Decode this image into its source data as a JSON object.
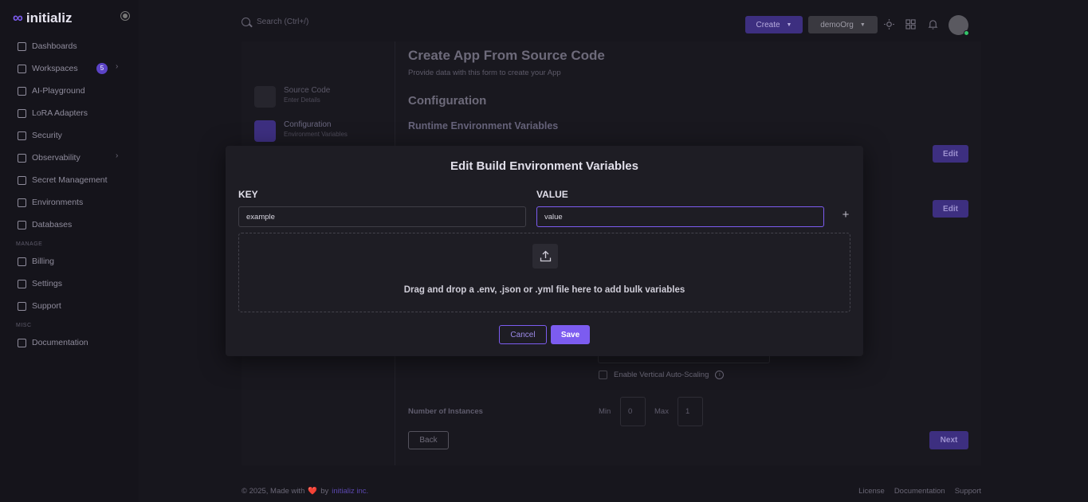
{
  "app": {
    "logo_mark": "∞",
    "brand": "initializ"
  },
  "sidebar": {
    "items": [
      {
        "label": "Dashboards",
        "icon": "dashboard-icon"
      },
      {
        "label": "Workspaces",
        "icon": "workspace-icon",
        "badge": "5",
        "chevron": "›"
      },
      {
        "label": "AI-Playground",
        "icon": "ai-icon"
      },
      {
        "label": "LoRA Adapters",
        "icon": "layers-icon"
      },
      {
        "label": "Security",
        "icon": "shield-icon"
      },
      {
        "label": "Observability",
        "icon": "observability-icon",
        "chevron": "›"
      },
      {
        "label": "Secret Management",
        "icon": "lock-icon"
      },
      {
        "label": "Environments",
        "icon": "environment-icon"
      },
      {
        "label": "Databases",
        "icon": "database-icon"
      }
    ],
    "manage_header": "MANAGE",
    "manage_items": [
      {
        "label": "Billing",
        "icon": "billing-icon"
      },
      {
        "label": "Settings",
        "icon": "gear-icon"
      },
      {
        "label": "Support",
        "icon": "headset-icon"
      }
    ],
    "misc_header": "MISC",
    "misc_items": [
      {
        "label": "Documentation",
        "icon": "document-icon"
      }
    ]
  },
  "topbar": {
    "search_placeholder": "Search (Ctrl+/)",
    "create_label": "Create",
    "org_label": "demoOrg",
    "caret": "▼",
    "icons": [
      "sun-icon",
      "apps-grid-icon",
      "bell-icon"
    ]
  },
  "stepper": [
    {
      "title": "Source Code",
      "subtitle": "Enter Details"
    },
    {
      "title": "Configuration",
      "subtitle": "Environment Variables"
    }
  ],
  "form": {
    "title": "Create App From Source Code",
    "subtitle": "Provide data with this form to create your App",
    "section": "Configuration",
    "subsection": "Runtime Environment Variables",
    "edit_label": "Edit",
    "autoscaling_label": "Enable Vertical Auto-Scaling",
    "instances_label": "Number of Instances",
    "min_label": "Min",
    "min_value": "0",
    "max_label": "Max",
    "max_value": "1",
    "back_label": "Back",
    "next_label": "Next"
  },
  "footer": {
    "copyright": "© 2025, Made with",
    "heart": "❤️",
    "by": "by",
    "brand": "initializ inc.",
    "links": [
      "License",
      "Documentation",
      "Support"
    ]
  },
  "modal": {
    "title": "Edit Build Environment Variables",
    "key_header": "KEY",
    "value_header": "VALUE",
    "key_value": "example",
    "value_value": "value",
    "add_glyph": "+",
    "dropzone_text": "Drag and drop a .env, .json or .yml file here to add bulk variables",
    "cancel_label": "Cancel",
    "save_label": "Save"
  },
  "colors": {
    "accent": "#7c5cf0",
    "background": "#0f0e14",
    "modal": "#1e1d24"
  }
}
